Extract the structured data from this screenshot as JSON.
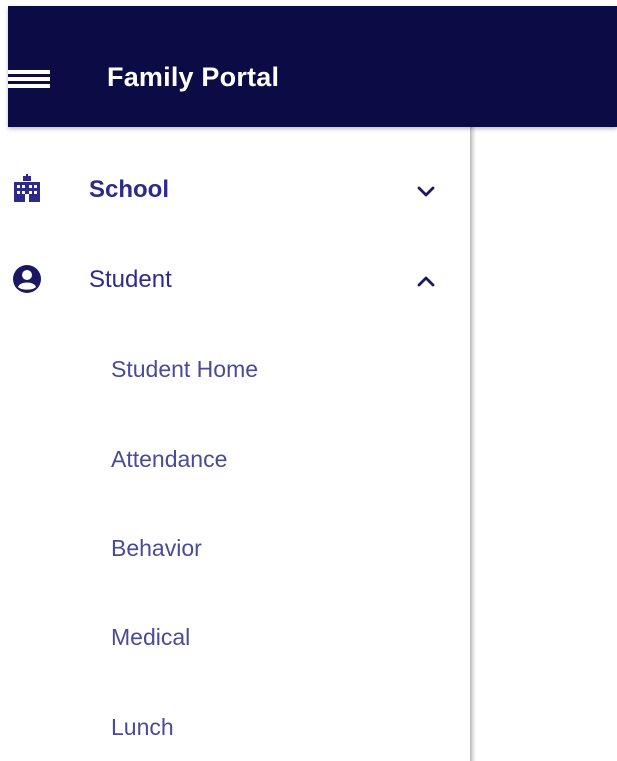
{
  "header": {
    "title": "Family Portal",
    "menu_icon": "hamburger-menu-icon",
    "background": "#0b0b45"
  },
  "sidebar": {
    "groups": [
      {
        "label": "School",
        "icon": "school-building-icon",
        "expanded": false,
        "active": true
      },
      {
        "label": "Student",
        "icon": "account-circle-icon",
        "expanded": true,
        "active": false
      }
    ],
    "student_items": [
      {
        "label": "Student Home"
      },
      {
        "label": "Attendance"
      },
      {
        "label": "Behavior"
      },
      {
        "label": "Medical"
      },
      {
        "label": "Lunch"
      }
    ]
  },
  "colors": {
    "primary": "#0b0b45",
    "nav_text": "#2e2a8c",
    "sub_text": "#4a4a9a"
  }
}
